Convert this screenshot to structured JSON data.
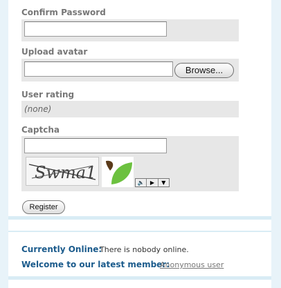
{
  "form": {
    "confirm_password": {
      "label": "Confirm Password",
      "value": ""
    },
    "upload_avatar": {
      "label": "Upload avatar",
      "value": "",
      "browse_label": "Browse..."
    },
    "user_rating": {
      "label": "User rating",
      "value": "(none)"
    },
    "captcha": {
      "label": "Captcha",
      "value": "",
      "image_text": "Swma1"
    },
    "register_label": "Register"
  },
  "online": {
    "currently_online_label": "Currently Online:",
    "currently_online_text": "There is nobody online.",
    "latest_member_label": "Welcome to our latest member:",
    "latest_member_link": "Anonymous user"
  },
  "colors": {
    "accent": "#1b5b8c",
    "panel_border": "#d9ecf5",
    "row_background": "#e7e7e7",
    "logo_brown": "#5a3a1a",
    "logo_green": "#6cc13f"
  },
  "icons": [
    "speaker-icon",
    "play-icon",
    "dropdown-arrow-icon"
  ]
}
